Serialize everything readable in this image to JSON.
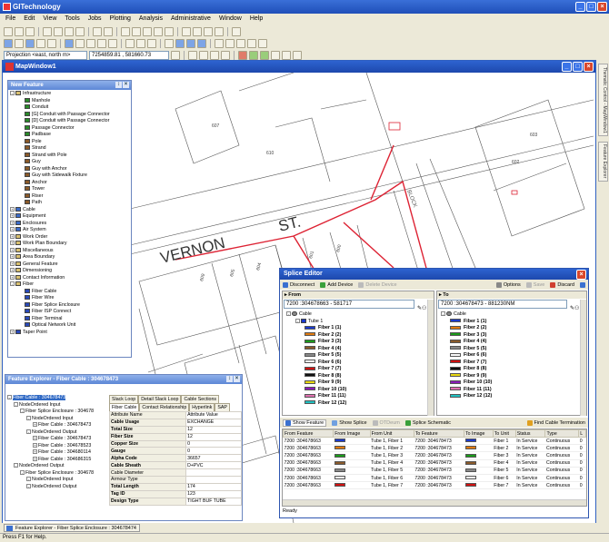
{
  "app": {
    "title": "GITechnology"
  },
  "menu": [
    "File",
    "Edit",
    "View",
    "Tools",
    "Jobs",
    "Plotting",
    "Analysis",
    "Administrative",
    "Window",
    "Help"
  ],
  "toolbar": {
    "projection": "Projection <east, north m>",
    "coords": "7254859.81 , 581660.73"
  },
  "mapwindow": {
    "title": "MapWindow1",
    "labels": {
      "street1": "VERNON",
      "street2": "ST.",
      "block": "BLOCK",
      "lot_numbers": [
        "609",
        "605",
        "604",
        "601",
        "600",
        "606",
        "610",
        "603",
        "602",
        "607"
      ]
    }
  },
  "new_feature": {
    "title": "New Feature",
    "items": [
      {
        "label": "Infrastructure",
        "level": 0,
        "exp": "-",
        "icon": "#d8c070"
      },
      {
        "label": "Manhole",
        "level": 1,
        "icon": "#2a8a2a"
      },
      {
        "label": "Conduit",
        "level": 1,
        "icon": "#2a8a2a"
      },
      {
        "label": "[G] Conduit with Passage Connector",
        "level": 1,
        "icon": "#2a8a2a"
      },
      {
        "label": "[D] Conduit with Passage Connector",
        "level": 1,
        "icon": "#2a8a2a"
      },
      {
        "label": "Passage Connector",
        "level": 1,
        "icon": "#2a8a2a"
      },
      {
        "label": "Padbase",
        "level": 1,
        "icon": "#2a8a2a"
      },
      {
        "label": "Pole",
        "level": 1,
        "icon": "#8a5a2a"
      },
      {
        "label": "Strand",
        "level": 1,
        "icon": "#8a5a2a"
      },
      {
        "label": "Strand with Pole",
        "level": 1,
        "icon": "#8a5a2a"
      },
      {
        "label": "Guy",
        "level": 1,
        "icon": "#8a5a2a"
      },
      {
        "label": "Guy with Anchor",
        "level": 1,
        "icon": "#8a5a2a"
      },
      {
        "label": "Guy with Sidewalk Fixture",
        "level": 1,
        "icon": "#8a5a2a"
      },
      {
        "label": "Anchor",
        "level": 1,
        "icon": "#8a5a2a"
      },
      {
        "label": "Tower",
        "level": 1,
        "icon": "#8a5a2a"
      },
      {
        "label": "Riser",
        "level": 1,
        "icon": "#8a5a2a"
      },
      {
        "label": "Path",
        "level": 1,
        "icon": "#8a5a2a"
      },
      {
        "label": "Cable",
        "level": 0,
        "exp": "+",
        "icon": "#3c6cc8"
      },
      {
        "label": "Equipment",
        "level": 0,
        "exp": "+",
        "icon": "#3c6cc8"
      },
      {
        "label": "Enclosures",
        "level": 0,
        "exp": "+",
        "icon": "#3c6cc8"
      },
      {
        "label": "Air System",
        "level": 0,
        "exp": "+",
        "icon": "#3c6cc8"
      },
      {
        "label": "Work Order",
        "level": 0,
        "exp": "+",
        "icon": "#d8c070"
      },
      {
        "label": "Work Plan Boundary",
        "level": 0,
        "exp": "+",
        "icon": "#d8c070"
      },
      {
        "label": "Miscellaneous",
        "level": 0,
        "exp": "+",
        "icon": "#d8c070"
      },
      {
        "label": "Area Boundary",
        "level": 0,
        "exp": "+",
        "icon": "#d8c070"
      },
      {
        "label": "General Feature",
        "level": 0,
        "exp": "+",
        "icon": "#d8c070"
      },
      {
        "label": "Dimensioning",
        "level": 0,
        "exp": "+",
        "icon": "#d8c070"
      },
      {
        "label": "Contact Information",
        "level": 0,
        "exp": "+",
        "icon": "#d8c070"
      },
      {
        "label": "Fiber",
        "level": 0,
        "exp": "-",
        "icon": "#d8c070"
      },
      {
        "label": "Fiber Cable",
        "level": 1,
        "icon": "#2a4ab8"
      },
      {
        "label": "Fiber Wire",
        "level": 1,
        "icon": "#2a4ab8"
      },
      {
        "label": "Fiber Splice Enclosure",
        "level": 1,
        "icon": "#2a4ab8"
      },
      {
        "label": "Fiber ISP Connect",
        "level": 1,
        "icon": "#2a4ab8"
      },
      {
        "label": "Fiber Terminal",
        "level": 1,
        "icon": "#2a4ab8"
      },
      {
        "label": "Optical Network Unit",
        "level": 1,
        "icon": "#2a4ab8"
      },
      {
        "label": "Taper Point",
        "level": 0,
        "exp": "+",
        "icon": "#2a4ab8"
      }
    ]
  },
  "feature_explorer": {
    "title": "Feature Explorer - Fiber Cable : 304678473",
    "tree": [
      {
        "label": "Fiber Cable : 304678473",
        "level": 0,
        "sel": true
      },
      {
        "label": "NodeOrdered Input",
        "level": 1
      },
      {
        "label": "Fiber Splice Enclosure : 304678",
        "level": 2
      },
      {
        "label": "NodeOrdered Input",
        "level": 3
      },
      {
        "label": "Fiber Cable : 304678473",
        "level": 4
      },
      {
        "label": "NodeOrdered Output",
        "level": 3
      },
      {
        "label": "Fiber Cable : 304678473",
        "level": 4
      },
      {
        "label": "Fiber Cable : 304678523",
        "level": 4
      },
      {
        "label": "Fiber Cable : 304680114",
        "level": 4
      },
      {
        "label": "Fiber Cable : 304686315",
        "level": 4
      },
      {
        "label": "NodeOrdered Output",
        "level": 1
      },
      {
        "label": "Fiber Splice Enclosure : 304678",
        "level": 2
      },
      {
        "label": "NodeOrdered Input",
        "level": 3
      },
      {
        "label": "NodeOrdered Output",
        "level": 3
      }
    ],
    "tabs_row1": [
      "Slack Loop",
      "Detail Slack Loop",
      "Cable Sections"
    ],
    "tabs_row2": [
      "Fiber Cable",
      "Contact Relationship",
      "Hyperlink",
      "SAP"
    ],
    "prop_header": [
      "Attribute Name",
      "Attribute Value"
    ],
    "props": [
      [
        "Cable Usage",
        "EXCHANGE"
      ],
      [
        "Total Size",
        "12"
      ],
      [
        "Fiber Size",
        "12"
      ],
      [
        "Copper Size",
        "0"
      ],
      [
        "Gauge",
        "0"
      ],
      [
        "Alpha Code",
        "36657"
      ],
      [
        "Cable Sheath",
        "D+PVC"
      ],
      [
        "Cable Diameter",
        ""
      ],
      [
        "Armour Type",
        ""
      ],
      [
        "Total Length",
        "174"
      ],
      [
        "Tag ID",
        "123"
      ],
      [
        "Design Type",
        "TIGHT BUF TUBE"
      ]
    ]
  },
  "splice_editor": {
    "title": "Splice Editor",
    "toolbar": {
      "disconnect": "Disconnect",
      "add_device": "Add Device",
      "delete_device": "Delete Device",
      "options": "Options",
      "save": "Save",
      "discard": "Discard"
    },
    "from_label": "From",
    "to_label": "To",
    "from_combo": "7200 :304678663 - 581717",
    "to_combo": "7200 :304678473 - 881230NM",
    "from_tree": {
      "root": "Cable",
      "sub": "Tube 1"
    },
    "to_tree": {
      "root": "Cable"
    },
    "fibers": [
      {
        "label": "Fiber 1",
        "n": "(1)",
        "color": "#1a3acc"
      },
      {
        "label": "Fiber 2",
        "n": "(2)",
        "color": "#e07a10"
      },
      {
        "label": "Fiber 3",
        "n": "(3)",
        "color": "#1a9a1a"
      },
      {
        "label": "Fiber 4",
        "n": "(4)",
        "color": "#8a5a2a"
      },
      {
        "label": "Fiber 5",
        "n": "(5)",
        "color": "#888888"
      },
      {
        "label": "Fiber 6",
        "n": "(6)",
        "color": "#f8f8f8"
      },
      {
        "label": "Fiber 7",
        "n": "(7)",
        "color": "#d01010"
      },
      {
        "label": "Fiber 8",
        "n": "(8)",
        "color": "#101010"
      },
      {
        "label": "Fiber 9",
        "n": "(9)",
        "color": "#e8d810"
      },
      {
        "label": "Fiber 10",
        "n": "(10)",
        "color": "#8a1ab8"
      },
      {
        "label": "Fiber 11",
        "n": "(11)",
        "color": "#e070b0"
      },
      {
        "label": "Fiber 12",
        "n": "(12)",
        "color": "#20c0c0"
      }
    ],
    "bottom_tabs": {
      "show_feature": "Show Feature",
      "show_splice": "Show Splice",
      "otdr": "OTDeum",
      "splice_schematic": "Splice Schematic",
      "find": "Find Cable Termination"
    },
    "grid_headers": [
      "From Feature",
      "From Image",
      "From Unit",
      "To Feature",
      "To Image",
      "To Unit",
      "Status",
      "Type",
      "L"
    ],
    "rows": [
      [
        "7200 :304678663",
        "#1a3acc",
        "Tube 1, Fiber 1",
        "7200 :304678473",
        "#1a3acc",
        "Fiber 1",
        "In Service",
        "Continuous",
        "0"
      ],
      [
        "7200 :304678663",
        "#e07a10",
        "Tube 1, Fiber 2",
        "7200 :304678473",
        "#e07a10",
        "Fiber 2",
        "In Service",
        "Continuous",
        "0"
      ],
      [
        "7200 :304678663",
        "#1a9a1a",
        "Tube 1, Fiber 3",
        "7200 :304678473",
        "#1a9a1a",
        "Fiber 3",
        "In Service",
        "Continuous",
        "0"
      ],
      [
        "7200 :304678663",
        "#8a5a2a",
        "Tube 1, Fiber 4",
        "7200 :304678473",
        "#8a5a2a",
        "Fiber 4",
        "In Service",
        "Continuous",
        "0"
      ],
      [
        "7200 :304678663",
        "#888888",
        "Tube 1, Fiber 5",
        "7200 :304678473",
        "#888888",
        "Fiber 5",
        "In Service",
        "Continuous",
        "0"
      ],
      [
        "7200 :304678663",
        "#f8f8f8",
        "Tube 1, Fiber 6",
        "7200 :304678473",
        "#f8f8f8",
        "Fiber 6",
        "In Service",
        "Continuous",
        "0"
      ],
      [
        "7200 :304678663",
        "#d01010",
        "Tube 1, Fiber 7",
        "7200 :304678473",
        "#d01010",
        "Fiber 7",
        "In Service",
        "Continuous",
        "0"
      ]
    ],
    "status": "Ready"
  },
  "right_tabs": [
    "Feature Explorer - Fiber Splice Enclosure : 304678474"
  ],
  "side_tabs": [
    "Thematic Control - MapWindow1",
    "Feature Explorer"
  ],
  "statusbar": "Press F1 for Help."
}
